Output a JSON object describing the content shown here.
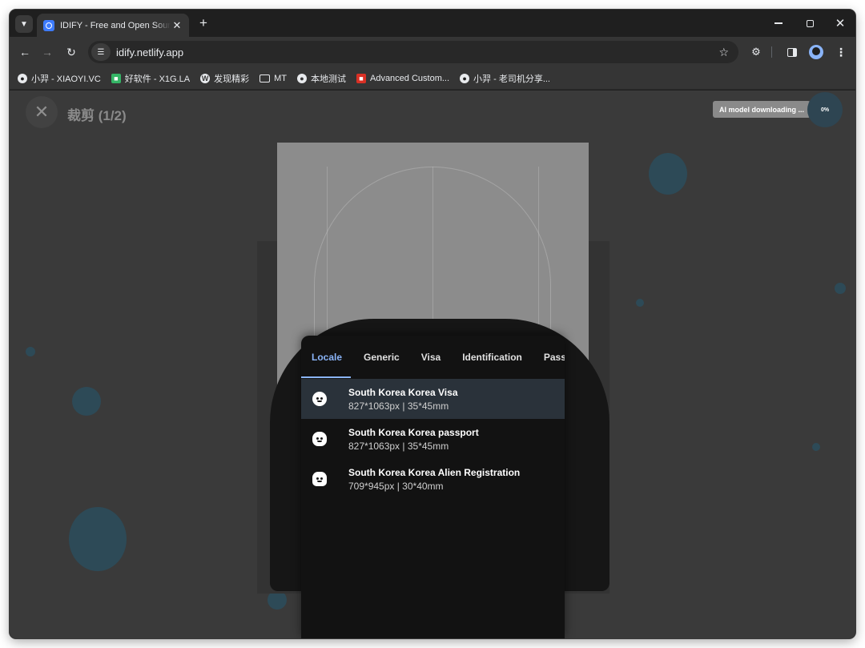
{
  "browser": {
    "tab_title": "IDIFY - Free and Open Source",
    "url": "idify.netlify.app",
    "bookmarks": [
      {
        "label": "小羿 - XIAOYI.VC",
        "icon": "avatar-icon"
      },
      {
        "label": "好软件 - X1G.LA",
        "icon": "green-square-icon"
      },
      {
        "label": "发现精彩",
        "icon": "wordpress-icon"
      },
      {
        "label": "MT",
        "icon": "folder-icon"
      },
      {
        "label": "本地测试",
        "icon": "globe-icon"
      },
      {
        "label": "Advanced Custom...",
        "icon": "red-app-icon"
      },
      {
        "label": "小羿 - 老司机分享...",
        "icon": "avatar-icon"
      }
    ]
  },
  "page": {
    "step_title": "裁剪 (1/2)",
    "ai_status": "AI model downloading ...",
    "ai_progress": "0%",
    "tabs": [
      "Locale",
      "Generic",
      "Visa",
      "Identification",
      "Passp"
    ],
    "active_tab": "Locale",
    "specs": [
      {
        "title": "South Korea Korea Visa",
        "sub": "827*1063px | 35*45mm"
      },
      {
        "title": "South Korea Korea passport",
        "sub": "827*1063px | 35*45mm"
      },
      {
        "title": "South Korea Korea Alien Registration",
        "sub": "709*945px | 30*40mm"
      }
    ]
  },
  "colors": {
    "accent": "#8ab4f8",
    "selected_row": "#2a323a",
    "page_bg": "#3a3a3a"
  }
}
